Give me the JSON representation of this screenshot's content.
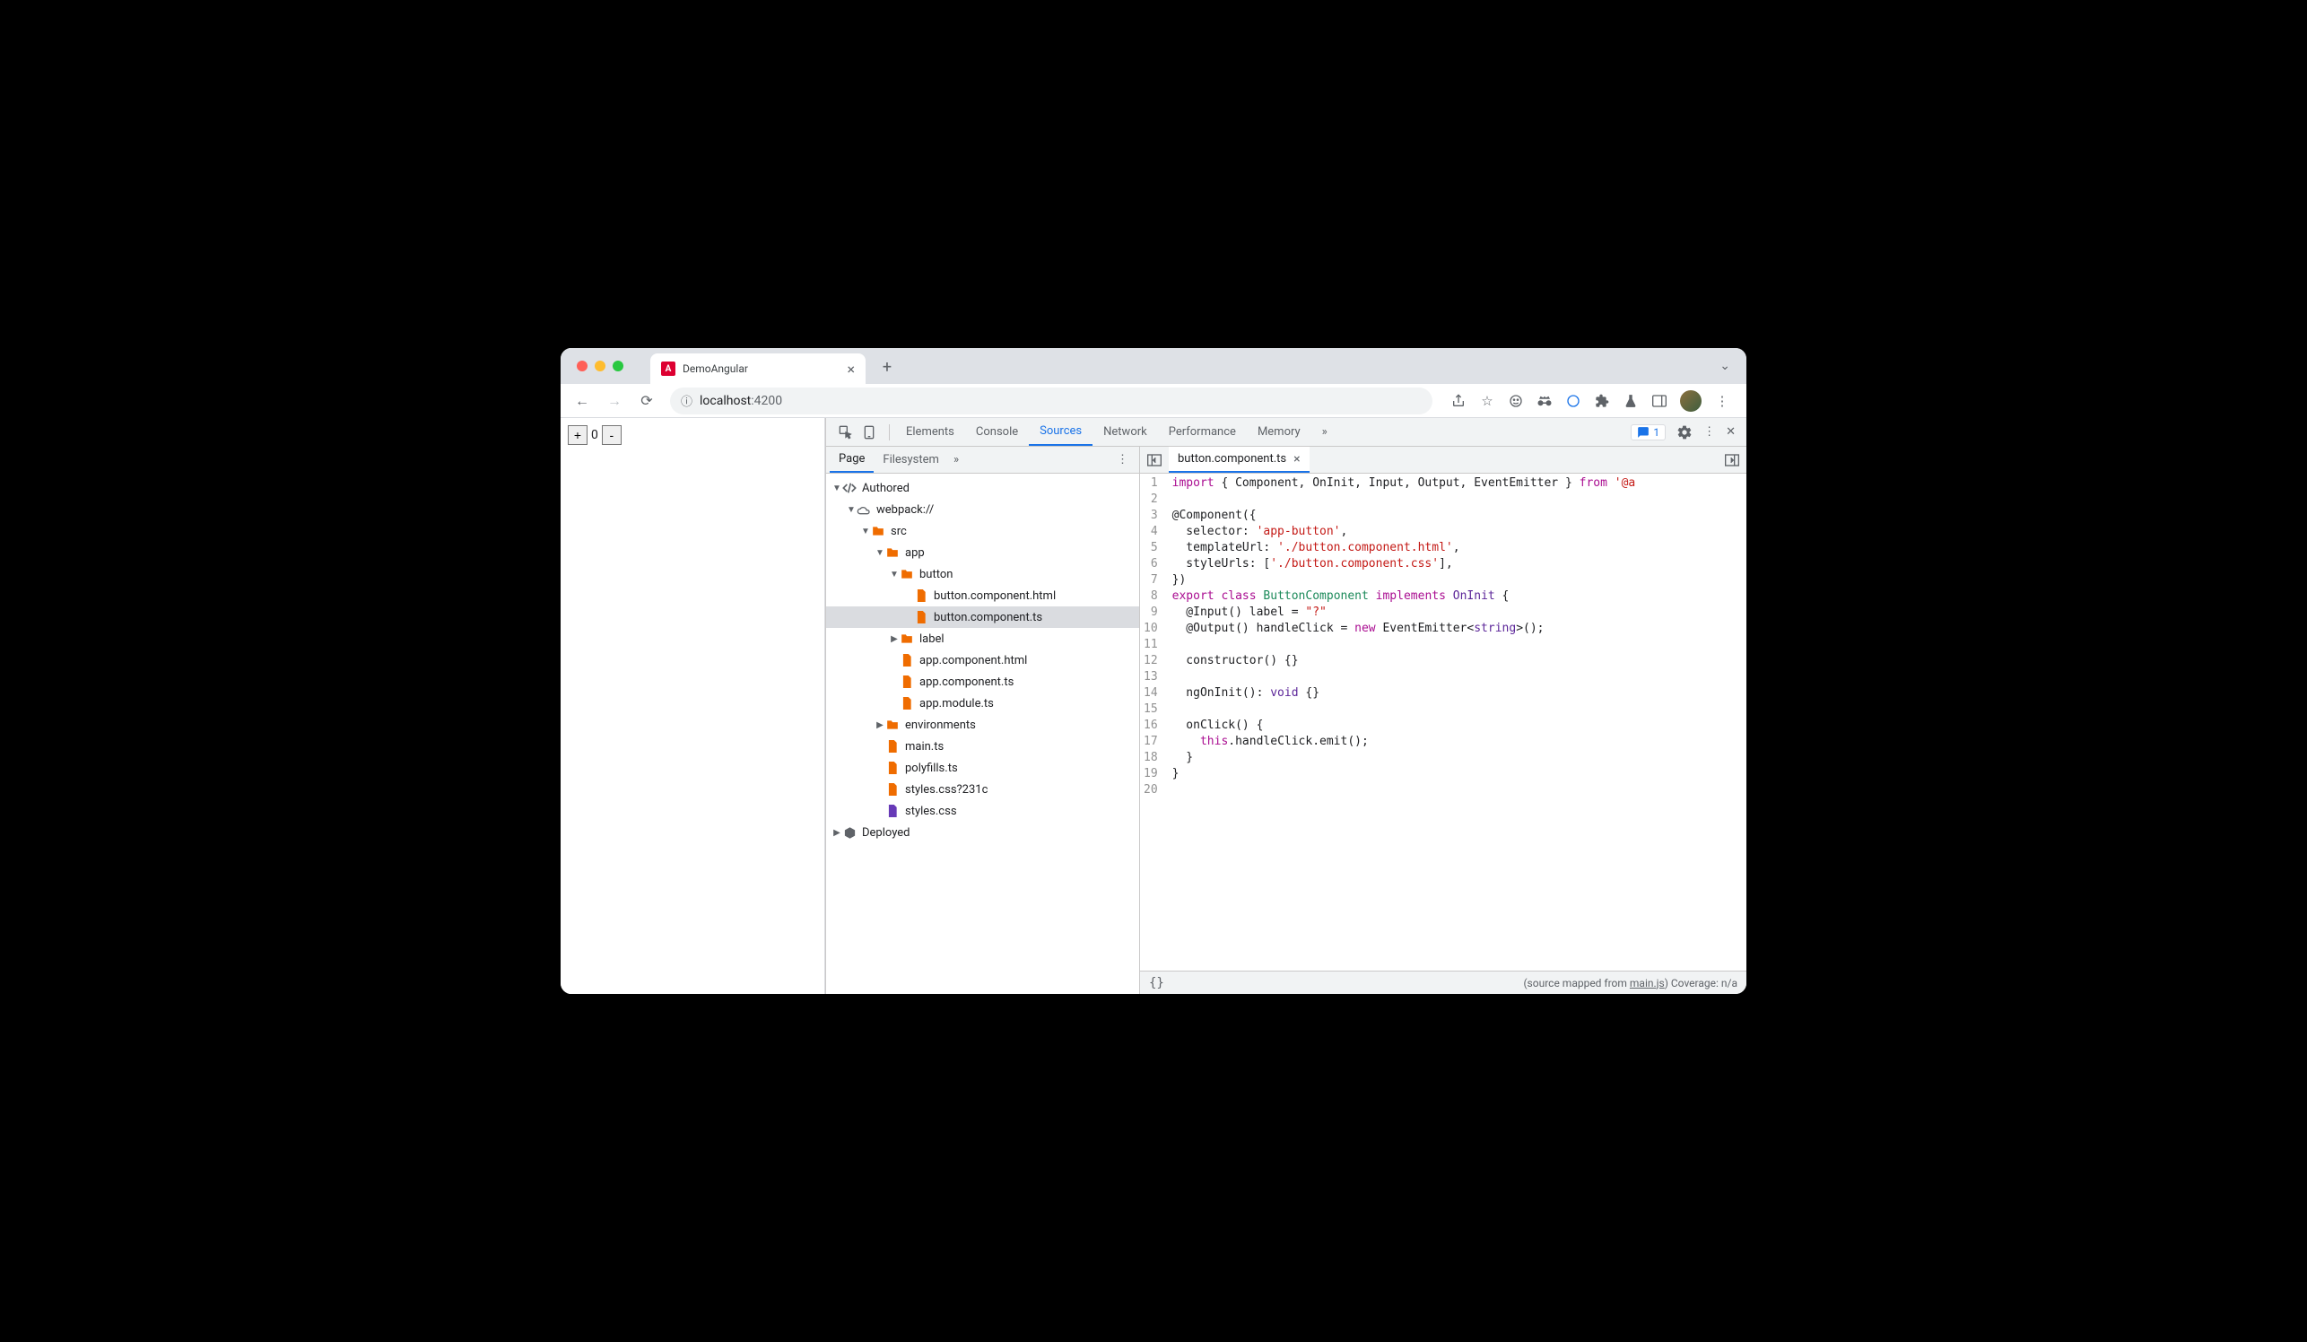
{
  "browser": {
    "tab_title": "DemoAngular",
    "url_host": "localhost",
    "url_port": ":4200"
  },
  "app": {
    "minus_label": "-",
    "plus_label": "+",
    "count": "0"
  },
  "devtools": {
    "tabs": [
      "Elements",
      "Console",
      "Sources",
      "Network",
      "Performance",
      "Memory"
    ],
    "active_tab": "Sources",
    "issues_count": "1",
    "nav_tabs": [
      "Page",
      "Filesystem"
    ],
    "nav_active": "Page",
    "tree": {
      "authored": "Authored",
      "webpack": "webpack://",
      "src": "src",
      "app": "app",
      "button": "button",
      "button_html": "button.component.html",
      "button_ts": "button.component.ts",
      "label": "label",
      "app_html": "app.component.html",
      "app_ts": "app.component.ts",
      "app_module": "app.module.ts",
      "environments": "environments",
      "main_ts": "main.ts",
      "polyfills": "polyfills.ts",
      "styles_q": "styles.css?231c",
      "styles": "styles.css",
      "deployed": "Deployed"
    },
    "editor_tab": "button.component.ts",
    "status_braces": "{}",
    "status_text_prefix": "(source mapped from ",
    "status_link": "main.js",
    "status_text_suffix": ")  Coverage: n/a"
  },
  "code": {
    "lines": [
      {
        "n": "1",
        "html": "<span class='k-import'>import</span> { Component, OnInit, Input, Output, EventEmitter } <span class='k-import'>from</span> <span class='k-string'>'@a</span>"
      },
      {
        "n": "2",
        "html": ""
      },
      {
        "n": "3",
        "html": "@Component({"
      },
      {
        "n": "4",
        "html": "  selector: <span class='k-string'>'app-button'</span>,"
      },
      {
        "n": "5",
        "html": "  templateUrl: <span class='k-string'>'./button.component.html'</span>,"
      },
      {
        "n": "6",
        "html": "  styleUrls: [<span class='k-string'>'./button.component.css'</span>],"
      },
      {
        "n": "7",
        "html": "})"
      },
      {
        "n": "8",
        "html": "<span class='k-keyword'>export</span> <span class='k-keyword'>class</span> <span class='k-class'>ButtonComponent</span> <span class='k-keyword'>implements</span> <span class='k-type'>OnInit</span> {"
      },
      {
        "n": "9",
        "html": "  @Input() label = <span class='k-string'>\"?\"</span>"
      },
      {
        "n": "10",
        "html": "  @Output() handleClick = <span class='k-new'>new</span> EventEmitter&lt;<span class='k-type'>string</span>&gt;();"
      },
      {
        "n": "11",
        "html": ""
      },
      {
        "n": "12",
        "html": "  constructor() {}"
      },
      {
        "n": "13",
        "html": ""
      },
      {
        "n": "14",
        "html": "  ngOnInit(): <span class='k-type'>void</span> {}"
      },
      {
        "n": "15",
        "html": ""
      },
      {
        "n": "16",
        "html": "  onClick() {"
      },
      {
        "n": "17",
        "html": "    <span class='k-keyword'>this</span>.handleClick.emit();"
      },
      {
        "n": "18",
        "html": "  }"
      },
      {
        "n": "19",
        "html": "}"
      },
      {
        "n": "20",
        "html": ""
      }
    ]
  }
}
